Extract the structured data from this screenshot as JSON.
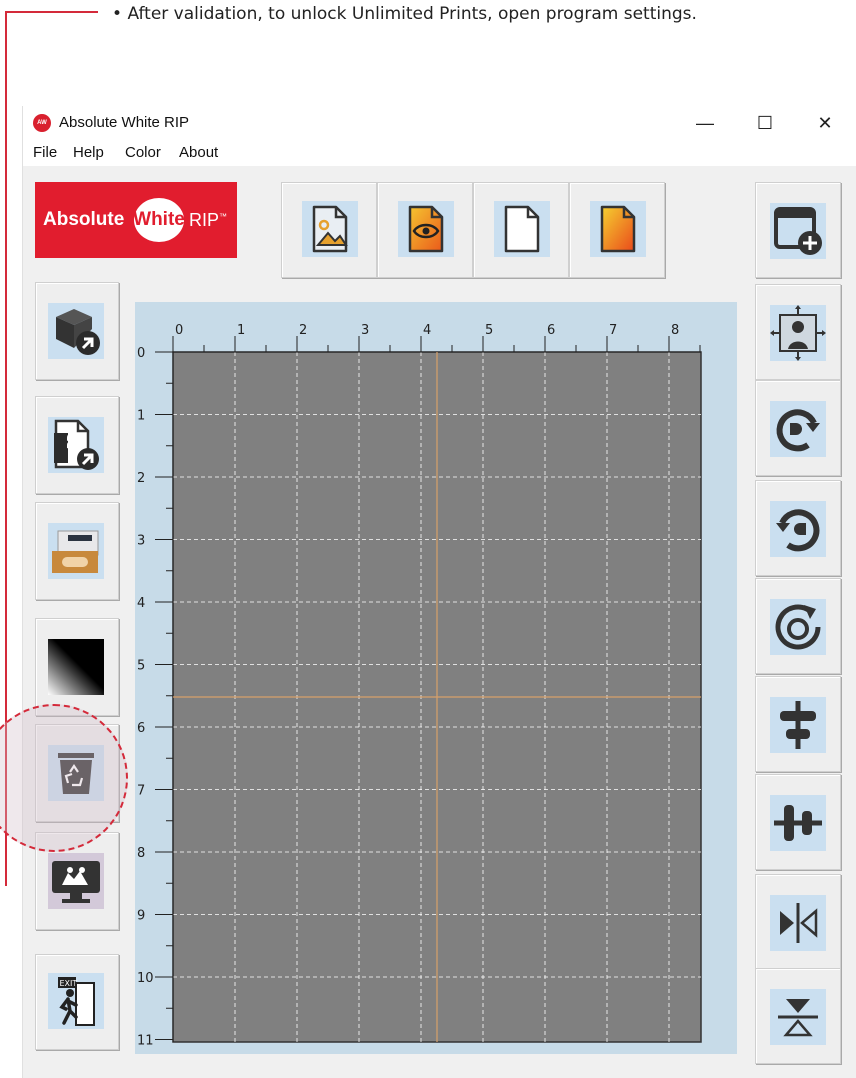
{
  "instruction": "After validation, to unlock Unlimited Prints, open program settings.",
  "window": {
    "title": "Absolute White RIP",
    "app_icon_text": "Absolute White",
    "controls": {
      "minimize": "—",
      "maximize": "☐",
      "close": "✕"
    }
  },
  "menu": [
    "File",
    "Help",
    "Color",
    "About"
  ],
  "logo": {
    "word1": "Absolute",
    "word2": "White",
    "word3": "RIP",
    "trademark": "™"
  },
  "top_toolbar": [
    "image-file-icon",
    "preview-file-icon",
    "blank-page-icon",
    "gradient-page-icon"
  ],
  "left_toolbar": [
    "import-package-icon",
    "import-pdf-icon",
    "printer-photo-icon",
    "gradient-icon",
    "recycle-bin-icon",
    "settings-monitor-icon",
    "exit-icon"
  ],
  "right_toolbar": [
    "new-window-add-icon",
    "fit-center-icon",
    "rotate-right-icon",
    "rotate-left-icon",
    "rotate-180-icon",
    "align-center-vertical-icon",
    "align-center-horizontal-icon",
    "flip-horizontal-icon",
    "flip-vertical-icon"
  ],
  "ruler": {
    "x_labels": [
      "0",
      "1",
      "2",
      "3",
      "4",
      "5",
      "6",
      "7",
      "8"
    ],
    "y_labels": [
      "0",
      "1",
      "2",
      "3",
      "4",
      "5",
      "6",
      "7",
      "8",
      "9",
      "10",
      "11"
    ]
  },
  "exit_label": "EXIT",
  "colors": {
    "accent": "#d42a3a",
    "canvas": "#808080",
    "canvas_frame": "#c7dbe8",
    "button_face": "#cadff0",
    "guide": "#d7a06a"
  }
}
